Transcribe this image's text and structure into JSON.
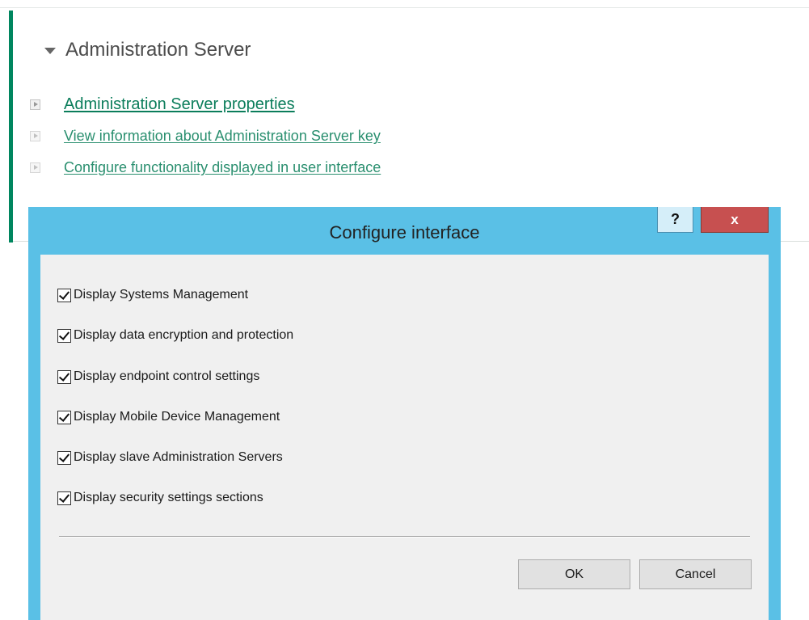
{
  "admin_panel": {
    "section_title": "Administration Server",
    "links": [
      {
        "label": "Administration Server properties"
      },
      {
        "label": "View information about Administration Server key"
      },
      {
        "label": "Configure functionality displayed in user interface"
      }
    ]
  },
  "dialog": {
    "title": "Configure interface",
    "help_label": "?",
    "close_label": "x",
    "checkboxes": [
      {
        "label": "Display Systems Management",
        "checked": true
      },
      {
        "label": "Display data encryption and protection",
        "checked": true
      },
      {
        "label": "Display endpoint control settings",
        "checked": true
      },
      {
        "label": "Display Mobile Device Management",
        "checked": true
      },
      {
        "label": "Display slave Administration Servers",
        "checked": true
      },
      {
        "label": "Display security settings sections",
        "checked": true
      }
    ],
    "ok_label": "OK",
    "cancel_label": "Cancel"
  },
  "colors": {
    "accent": "#00865f",
    "dialog_frame": "#5ac0e6",
    "close_button": "#c75050"
  },
  "icons": [
    "expand-triangle-icon",
    "play-arrow-icon",
    "help-icon",
    "close-icon",
    "checkmark-icon"
  ]
}
